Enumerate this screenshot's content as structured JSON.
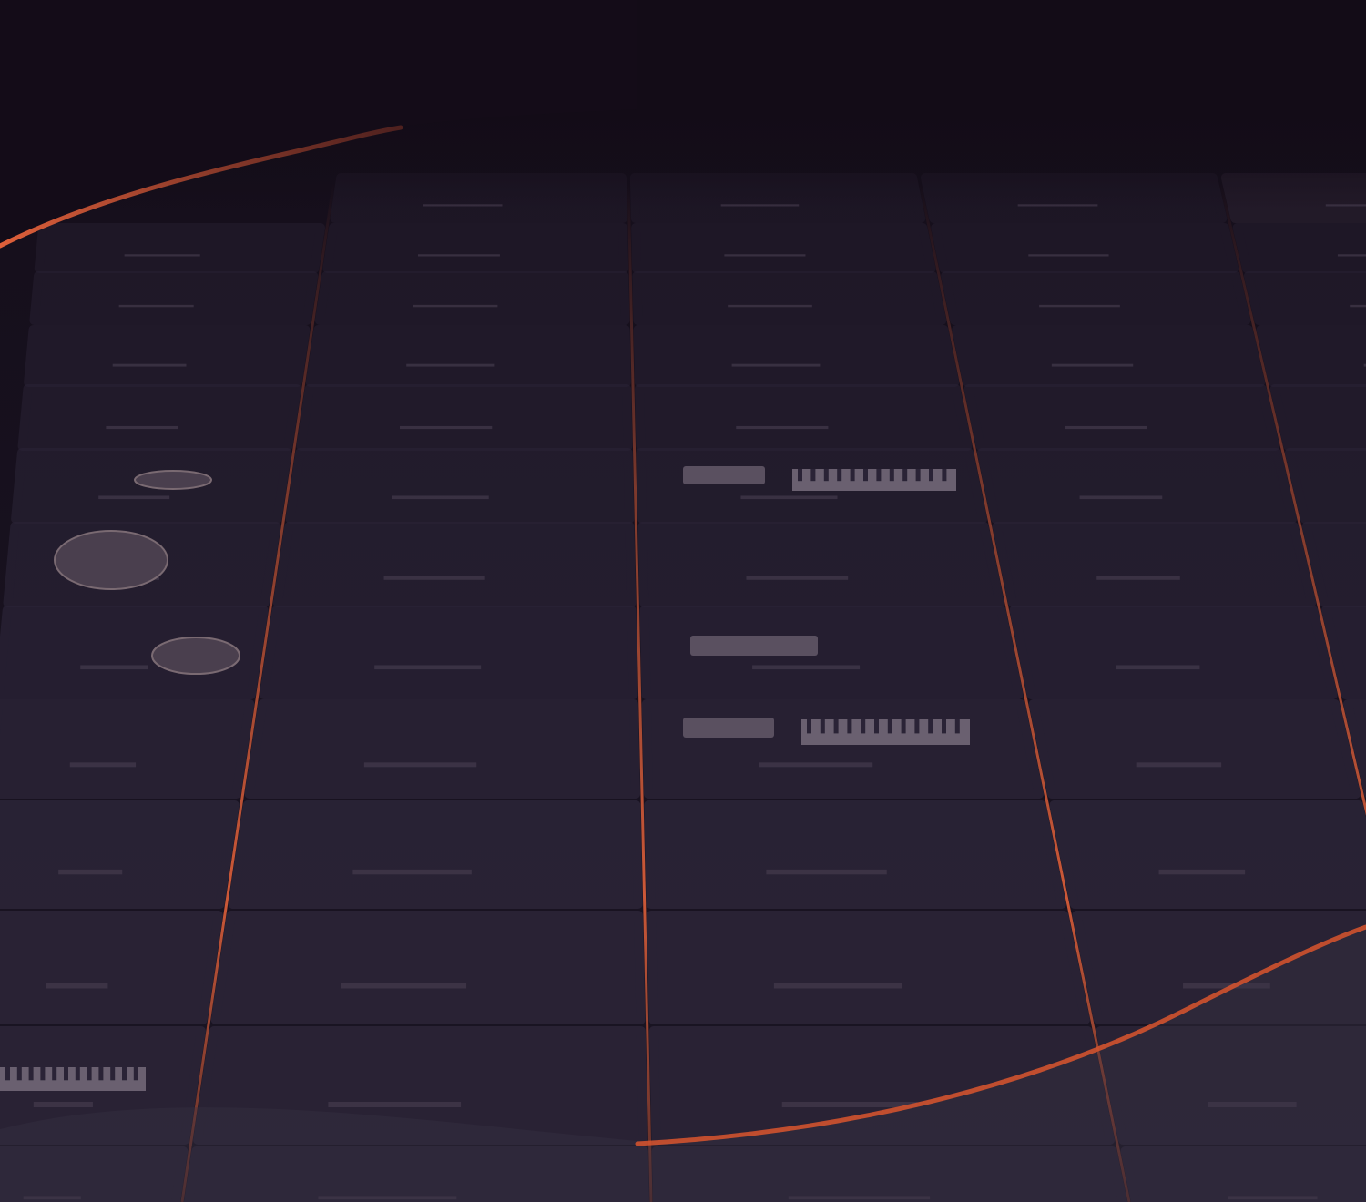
{
  "theme": {
    "background": "#15101b",
    "card": "#2a2336",
    "card_highlight": "#3a3040",
    "accent": "#e0603a",
    "wave": "#d9552e"
  }
}
